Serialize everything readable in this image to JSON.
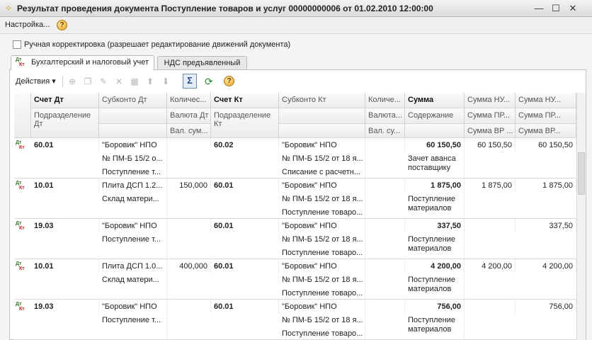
{
  "window": {
    "title": "Результат проведения документа Поступление товаров и услуг 00000000006 от 01.02.2010 12:00:00",
    "min_glyph": "—",
    "max_glyph": "☐",
    "close_glyph": "✕"
  },
  "menu": {
    "settings": "Настройка...",
    "help": "?"
  },
  "manual": {
    "label": "Ручная корректировка (разрешает редактирование движений документа)"
  },
  "tabs": [
    {
      "label": "Бухгалтерский и налоговый учет"
    },
    {
      "label": "НДС предъявленный"
    }
  ],
  "dtkt": {
    "dt": "Дт",
    "kt": "Кт"
  },
  "toolbar": {
    "actions": "Действия ▾",
    "sigma": "Σ",
    "refresh": "⟳",
    "help": "?"
  },
  "columns": {
    "h": [
      [
        "",
        "",
        ""
      ],
      [
        "Счет Дт",
        "Подразделение Дт",
        ""
      ],
      [
        "Субконто Дт",
        "",
        ""
      ],
      [
        "Количес...",
        "Валюта Дт",
        "Вал. сум..."
      ],
      [
        "Счет Кт",
        "Подразделение Кт",
        ""
      ],
      [
        "Субконто Кт",
        "",
        ""
      ],
      [
        "Количе...",
        "Валюта...",
        "Вал. су..."
      ],
      [
        "Сумма",
        "Содержание",
        ""
      ],
      [
        "Сумма НУ...",
        "Сумма ПР...",
        "Сумма ВР ..."
      ],
      [
        "Сумма НУ...",
        "Сумма ПР...",
        "Сумма ВР..."
      ]
    ]
  },
  "rows": [
    {
      "sdt": "60.01",
      "sub_dt": [
        "\"Боровик\" НПО",
        "№ ПМ-Б 15/2 о...",
        "Поступление т..."
      ],
      "kol_dt": "",
      "skt": "60.02",
      "sub_kt": [
        "\"Боровик\" НПО",
        "№ ПМ-Б 15/2 от 18 я...",
        "Списание с расчетн..."
      ],
      "summa": "60 150,50",
      "sod": "Зачет аванса поставщику",
      "nu_dt": "60 150,50",
      "nu_kt": "60 150,50"
    },
    {
      "sdt": "10.01",
      "sub_dt": [
        "Плита ДСП 1.2...",
        "Склад матери...",
        ""
      ],
      "kol_dt": "150,000",
      "skt": "60.01",
      "sub_kt": [
        "\"Боровик\" НПО",
        "№ ПМ-Б 15/2 от 18 я...",
        "Поступление товаро..."
      ],
      "summa": "1 875,00",
      "sod": "Поступление материалов",
      "nu_dt": "1 875,00",
      "nu_kt": "1 875,00"
    },
    {
      "sdt": "19.03",
      "sub_dt": [
        "\"Боровик\" НПО",
        "Поступление т...",
        ""
      ],
      "kol_dt": "",
      "skt": "60.01",
      "sub_kt": [
        "\"Боровик\" НПО",
        "№ ПМ-Б 15/2 от 18 я...",
        "Поступление товаро..."
      ],
      "summa": "337,50",
      "sod": "Поступление материалов",
      "nu_dt": "",
      "nu_kt": "337,50"
    },
    {
      "sdt": "10.01",
      "sub_dt": [
        "Плита ДСП 1.0...",
        "Склад матери...",
        ""
      ],
      "kol_dt": "400,000",
      "skt": "60.01",
      "sub_kt": [
        "\"Боровик\" НПО",
        "№ ПМ-Б 15/2 от 18 я...",
        "Поступление товаро..."
      ],
      "summa": "4 200,00",
      "sod": "Поступление материалов",
      "nu_dt": "4 200,00",
      "nu_kt": "4 200,00"
    },
    {
      "sdt": "19.03",
      "sub_dt": [
        "\"Боровик\" НПО",
        "Поступление т...",
        ""
      ],
      "kol_dt": "",
      "skt": "60.01",
      "sub_kt": [
        "\"Боровик\" НПО",
        "№ ПМ-Б 15/2 от 18 я...",
        "Поступление товаро..."
      ],
      "summa": "756,00",
      "sod": "Поступление материалов",
      "nu_dt": "",
      "nu_kt": "756,00"
    }
  ]
}
